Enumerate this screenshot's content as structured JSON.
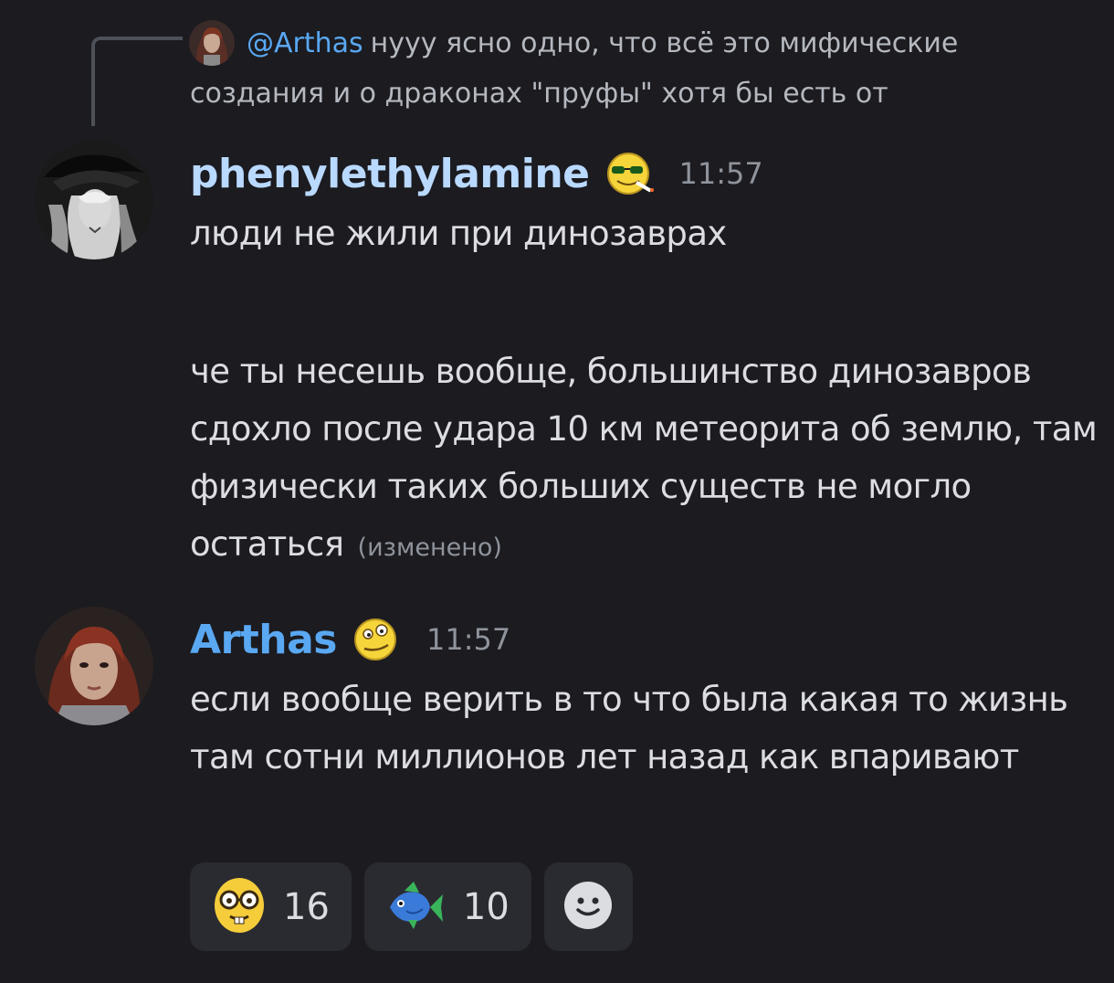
{
  "reply": {
    "mention": "@Arthas",
    "text": "нууу ясно одно, что всё это мифические создания и о драконах \"пруфы\" хотя бы есть от",
    "avatar_icon": "user-avatar-arthas"
  },
  "messages": [
    {
      "username": "phenylethylamine",
      "username_color": "#b9d9ff",
      "role_icon": "cool-smiley-sunglasses-cigarette-icon",
      "timestamp": "11:57",
      "lines": [
        "люди не жили при динозаврах",
        "",
        "че ты несешь вообще, большинство динозавров сдохло после удара 10 км метеорита об землю, там физически таких больших существ не могло остаться"
      ],
      "edited_label": "(изменено)"
    },
    {
      "username": "Arthas",
      "username_color": "#5aa8f2",
      "role_icon": "dizzy-smiley-icon",
      "timestamp": "11:57",
      "lines": [
        "если вообще верить в то что была какая то жизнь там сотни миллионов лет назад как впаривают"
      ]
    }
  ],
  "reactions": [
    {
      "emoji": "nerd-face-icon",
      "count": "16"
    },
    {
      "emoji": "blue-fish-icon",
      "count": "10"
    }
  ],
  "add_reaction_icon": "add-reaction-smiley-icon"
}
